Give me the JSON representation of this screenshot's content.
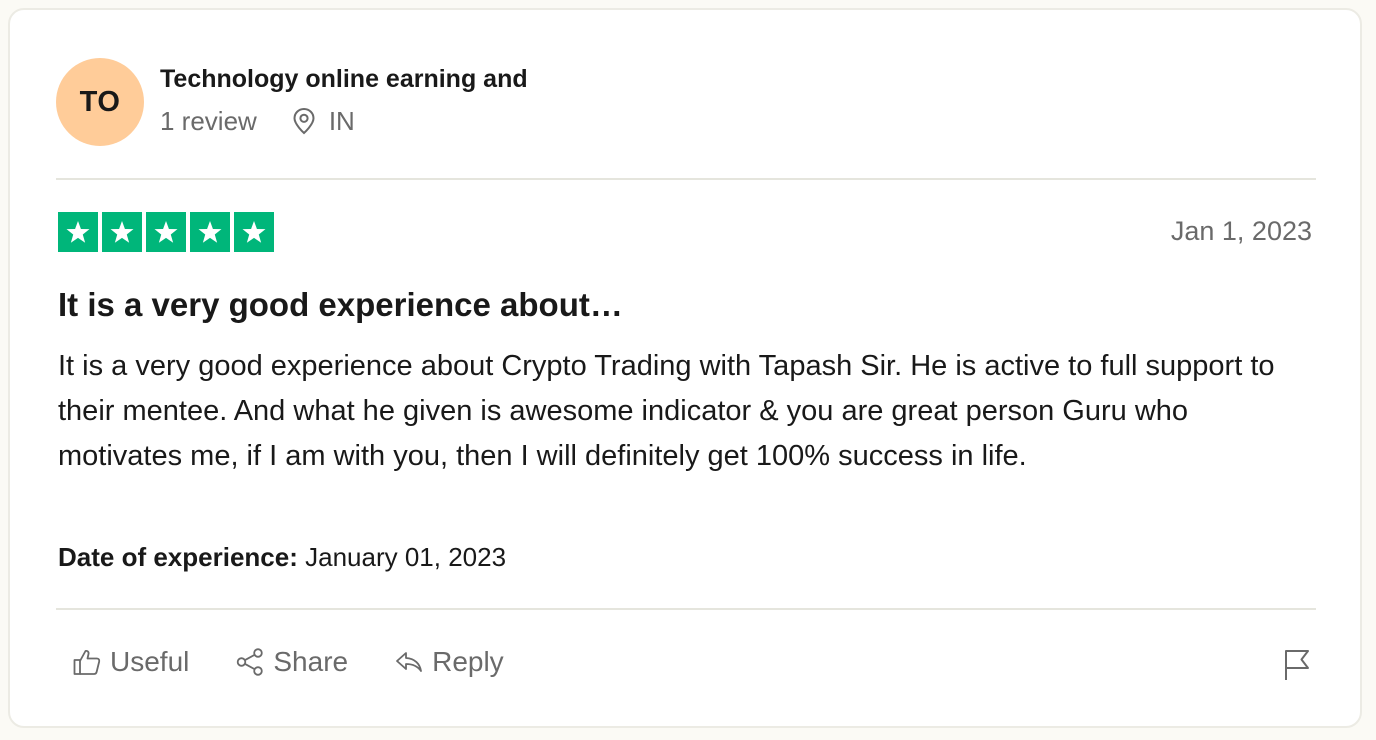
{
  "consumer": {
    "initials": "TO",
    "name": "Technology online earning and",
    "review_count": "1 review",
    "country": "IN"
  },
  "review": {
    "rating": 5,
    "date": "Jan 1, 2023",
    "title": "It is a very good experience about…",
    "text": "It is a very good experience about Crypto Trading with Tapash Sir. He is active to full support to their mentee. And what he given is awesome indicator & you are great person Guru who motivates me, if I am with you, then I will definitely get 100% success in life.",
    "experience_label": "Date of experience:",
    "experience_date": "January 01, 2023"
  },
  "actions": {
    "useful": "Useful",
    "share": "Share",
    "reply": "Reply"
  },
  "colors": {
    "star_green": "#00b67a",
    "avatar_bg": "#ffcc99"
  },
  "icons": [
    "location-pin-icon",
    "star-icon",
    "thumbs-up-icon",
    "share-icon",
    "reply-icon",
    "flag-icon"
  ]
}
